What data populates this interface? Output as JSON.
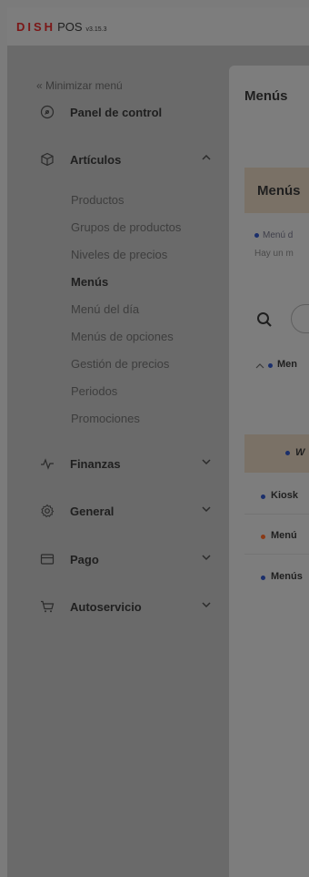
{
  "app": {
    "logo_dish": "DISH",
    "logo_pos": "POS",
    "version": "v3.15.3"
  },
  "sidebar": {
    "minimize_label": "« Minimizar menú",
    "items": [
      {
        "label": "Panel de control",
        "icon": "dashboard-icon"
      },
      {
        "label": "Artículos",
        "icon": "box-icon",
        "expanded": true
      },
      {
        "label": "Finanzas",
        "icon": "activity-icon"
      },
      {
        "label": "General",
        "icon": "gear-icon"
      },
      {
        "label": "Pago",
        "icon": "card-icon"
      },
      {
        "label": "Autoservicio",
        "icon": "cart-icon"
      }
    ],
    "subitems": [
      {
        "label": "Productos"
      },
      {
        "label": "Grupos de productos"
      },
      {
        "label": "Niveles de precios"
      },
      {
        "label": "Menús",
        "active": true
      },
      {
        "label": "Menú del día"
      },
      {
        "label": "Menús de opciones"
      },
      {
        "label": "Gestión de precios"
      },
      {
        "label": "Periodos"
      },
      {
        "label": "Promociones"
      }
    ]
  },
  "main": {
    "title": "Menús",
    "card_title": "Menús",
    "info_line1": "Menú d",
    "info_line2": "Hay un m",
    "tree": [
      {
        "label": "Men",
        "expanded": true,
        "dot_color": "#1b2f6b"
      },
      {
        "label": "W",
        "dot_color": "#1b2f6b",
        "selected": true
      },
      {
        "label": "Kiosk",
        "dot_color": "#1b2f6b"
      },
      {
        "label": "Menú",
        "dot_color": "#8a3a16"
      },
      {
        "label": "Menús",
        "dot_color": "#1b2f6b"
      }
    ]
  },
  "colors": {
    "brand_red": "#7b1616",
    "dot_blue": "#1b2f6b",
    "dot_orange": "#8a3a16"
  }
}
